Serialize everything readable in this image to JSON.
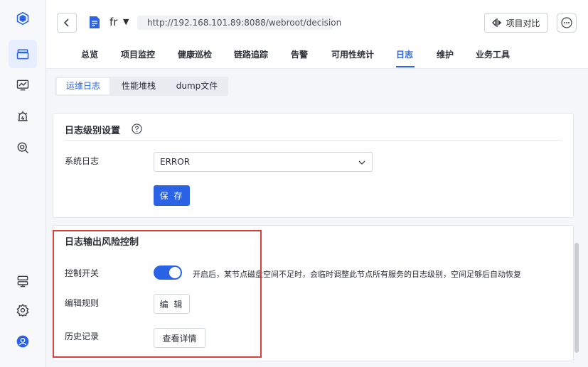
{
  "sidebar": {
    "items": [
      {
        "icon": "logo-cube-icon"
      },
      {
        "icon": "layers-icon",
        "active": true
      },
      {
        "icon": "monitor-chart-icon"
      },
      {
        "icon": "alarm-icon"
      },
      {
        "icon": "search-gear-icon"
      },
      {
        "icon": "server-icon"
      },
      {
        "icon": "settings-icon"
      },
      {
        "icon": "user-avatar-icon"
      }
    ]
  },
  "header": {
    "app_name": "fr",
    "url": "http://192.168.101.89:8088/webroot/decision",
    "compare_label": "项目对比",
    "tabs": [
      {
        "label": "总览"
      },
      {
        "label": "项目监控"
      },
      {
        "label": "健康巡检"
      },
      {
        "label": "链路追踪"
      },
      {
        "label": "告警"
      },
      {
        "label": "可用性统计"
      },
      {
        "label": "日志",
        "active": true
      },
      {
        "label": "维护"
      },
      {
        "label": "业务工具"
      }
    ]
  },
  "subtabs": [
    {
      "label": "运维日志",
      "active": true
    },
    {
      "label": "性能堆栈"
    },
    {
      "label": "dump文件"
    }
  ],
  "log_level_card": {
    "title": "日志级别设置",
    "system_log_label": "系统日志",
    "system_log_value": "ERROR",
    "save_label": "保 存"
  },
  "risk_card": {
    "title": "日志输出风险控制",
    "switch_label": "控制开关",
    "switch_on": true,
    "switch_hint": "开启后，某节点磁盘空间不足时，会临时调整此节点所有服务的日志级别，空间足够后自动恢复",
    "rules_label": "编辑规则",
    "edit_label": "编 辑",
    "history_label": "历史记录",
    "details_label": "查看详情"
  },
  "colors": {
    "accent": "#2b63e6",
    "highlight_box": "#d9403a"
  }
}
